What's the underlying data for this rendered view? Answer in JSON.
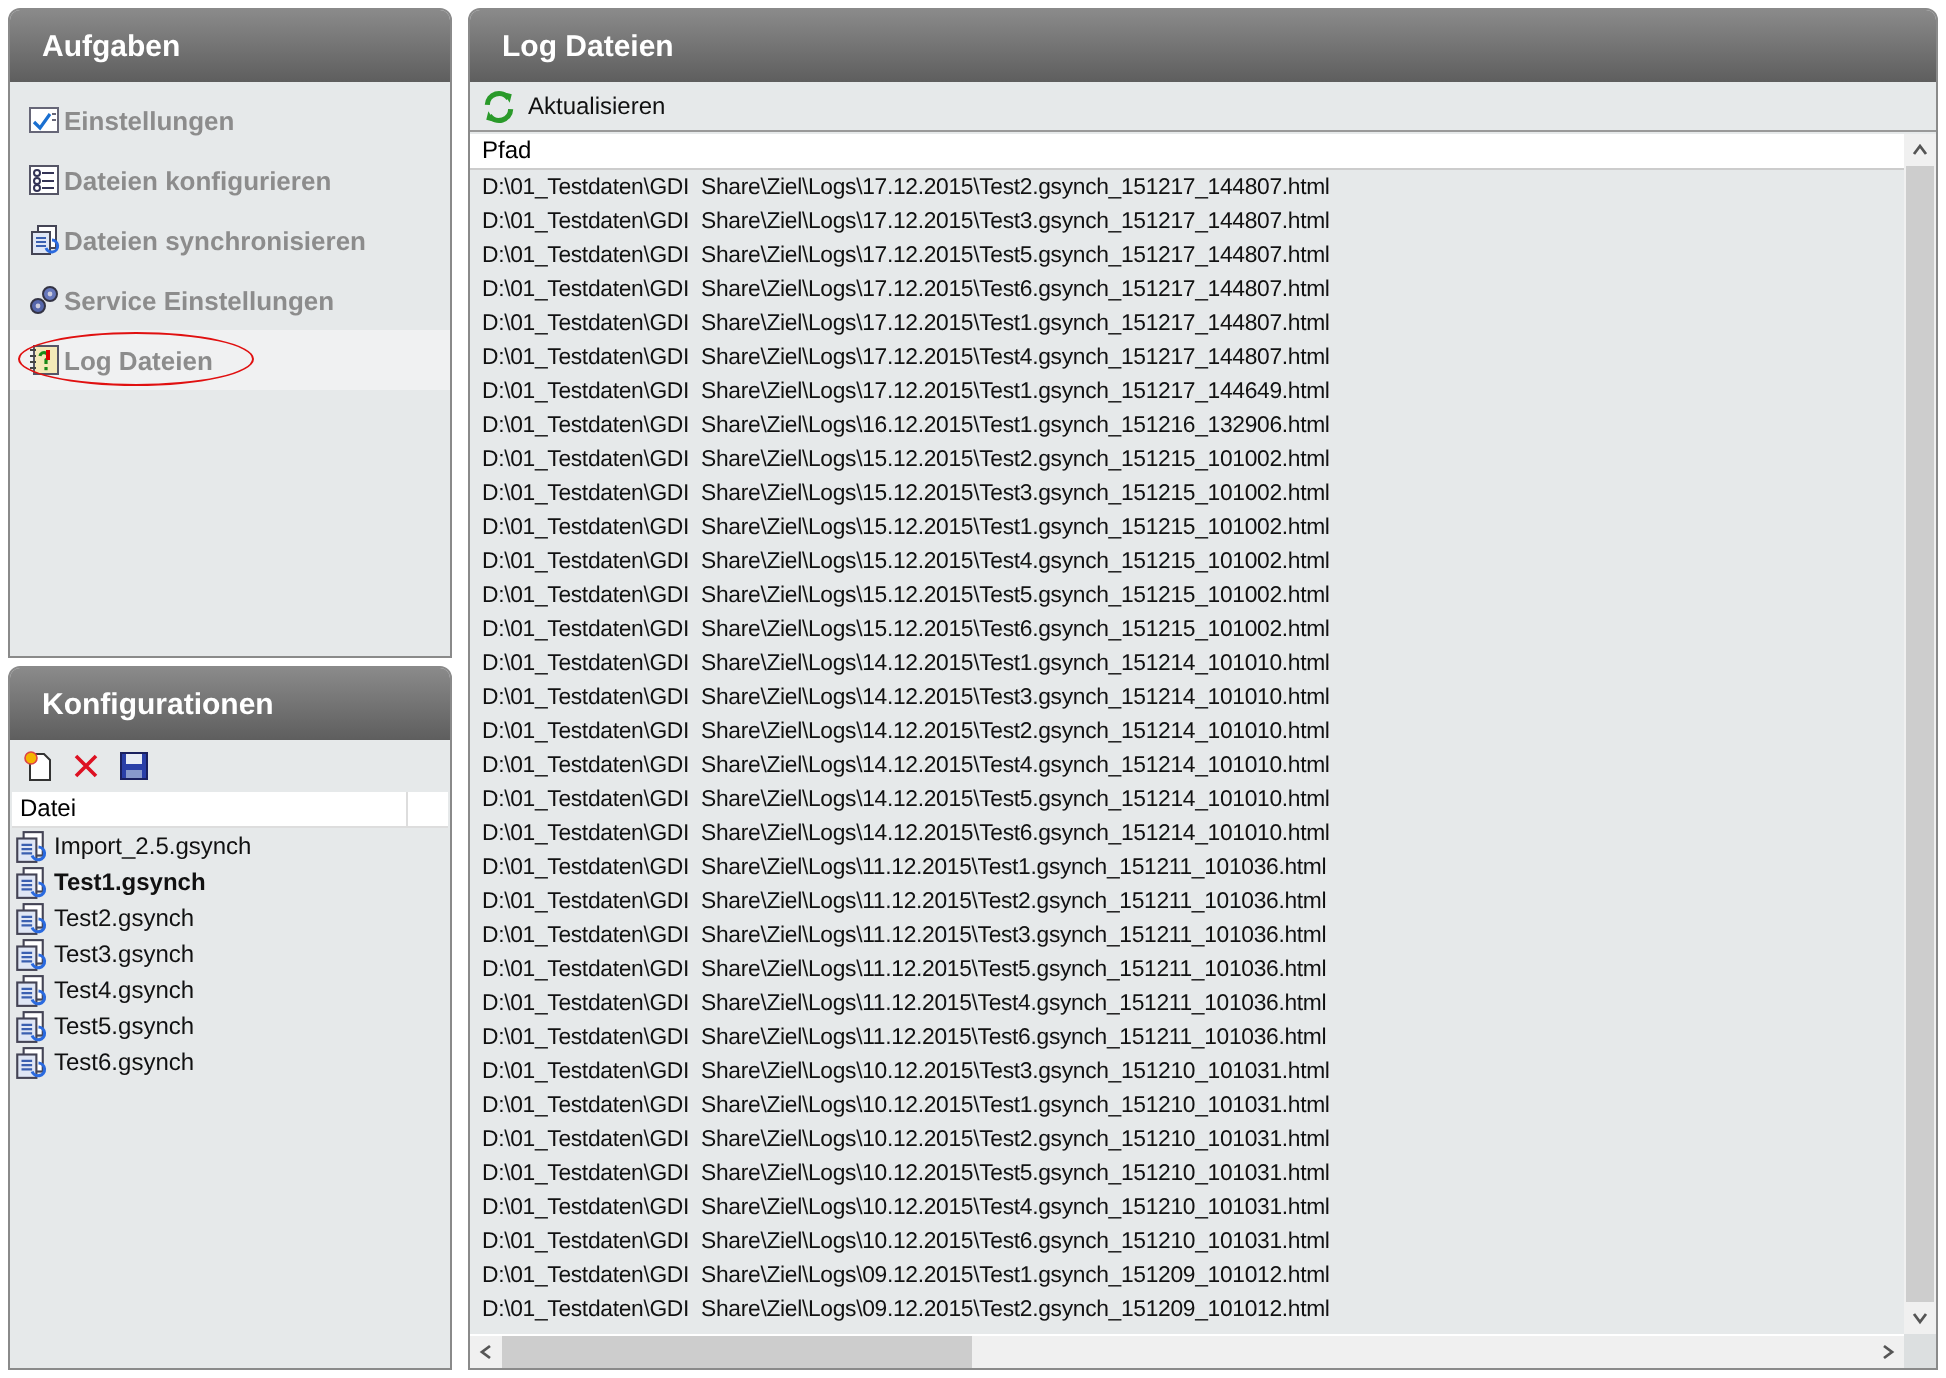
{
  "tasks_panel": {
    "title": "Aufgaben",
    "items": [
      {
        "label": "Einstellungen",
        "selected": false
      },
      {
        "label": "Dateien konfigurieren",
        "selected": false
      },
      {
        "label": "Dateien synchronisieren",
        "selected": false
      },
      {
        "label": "Service Einstellungen",
        "selected": false
      },
      {
        "label": "Log Dateien",
        "selected": true
      }
    ]
  },
  "configs_panel": {
    "title": "Konfigurationen",
    "column": "Datei",
    "files": [
      {
        "name": "Import_2.5.gsynch",
        "selected": false
      },
      {
        "name": "Test1.gsynch",
        "selected": true
      },
      {
        "name": "Test2.gsynch",
        "selected": false
      },
      {
        "name": "Test3.gsynch",
        "selected": false
      },
      {
        "name": "Test4.gsynch",
        "selected": false
      },
      {
        "name": "Test5.gsynch",
        "selected": false
      },
      {
        "name": "Test6.gsynch",
        "selected": false
      }
    ]
  },
  "log_panel": {
    "title": "Log Dateien",
    "refresh_button": "Aktualisieren",
    "column": "Pfad",
    "rows": [
      "D:\\01_Testdaten\\GDI  Share\\Ziel\\Logs\\17.12.2015\\Test2.gsynch_151217_144807.html",
      "D:\\01_Testdaten\\GDI  Share\\Ziel\\Logs\\17.12.2015\\Test3.gsynch_151217_144807.html",
      "D:\\01_Testdaten\\GDI  Share\\Ziel\\Logs\\17.12.2015\\Test5.gsynch_151217_144807.html",
      "D:\\01_Testdaten\\GDI  Share\\Ziel\\Logs\\17.12.2015\\Test6.gsynch_151217_144807.html",
      "D:\\01_Testdaten\\GDI  Share\\Ziel\\Logs\\17.12.2015\\Test1.gsynch_151217_144807.html",
      "D:\\01_Testdaten\\GDI  Share\\Ziel\\Logs\\17.12.2015\\Test4.gsynch_151217_144807.html",
      "D:\\01_Testdaten\\GDI  Share\\Ziel\\Logs\\17.12.2015\\Test1.gsynch_151217_144649.html",
      "D:\\01_Testdaten\\GDI  Share\\Ziel\\Logs\\16.12.2015\\Test1.gsynch_151216_132906.html",
      "D:\\01_Testdaten\\GDI  Share\\Ziel\\Logs\\15.12.2015\\Test2.gsynch_151215_101002.html",
      "D:\\01_Testdaten\\GDI  Share\\Ziel\\Logs\\15.12.2015\\Test3.gsynch_151215_101002.html",
      "D:\\01_Testdaten\\GDI  Share\\Ziel\\Logs\\15.12.2015\\Test1.gsynch_151215_101002.html",
      "D:\\01_Testdaten\\GDI  Share\\Ziel\\Logs\\15.12.2015\\Test4.gsynch_151215_101002.html",
      "D:\\01_Testdaten\\GDI  Share\\Ziel\\Logs\\15.12.2015\\Test5.gsynch_151215_101002.html",
      "D:\\01_Testdaten\\GDI  Share\\Ziel\\Logs\\15.12.2015\\Test6.gsynch_151215_101002.html",
      "D:\\01_Testdaten\\GDI  Share\\Ziel\\Logs\\14.12.2015\\Test1.gsynch_151214_101010.html",
      "D:\\01_Testdaten\\GDI  Share\\Ziel\\Logs\\14.12.2015\\Test3.gsynch_151214_101010.html",
      "D:\\01_Testdaten\\GDI  Share\\Ziel\\Logs\\14.12.2015\\Test2.gsynch_151214_101010.html",
      "D:\\01_Testdaten\\GDI  Share\\Ziel\\Logs\\14.12.2015\\Test4.gsynch_151214_101010.html",
      "D:\\01_Testdaten\\GDI  Share\\Ziel\\Logs\\14.12.2015\\Test5.gsynch_151214_101010.html",
      "D:\\01_Testdaten\\GDI  Share\\Ziel\\Logs\\14.12.2015\\Test6.gsynch_151214_101010.html",
      "D:\\01_Testdaten\\GDI  Share\\Ziel\\Logs\\11.12.2015\\Test1.gsynch_151211_101036.html",
      "D:\\01_Testdaten\\GDI  Share\\Ziel\\Logs\\11.12.2015\\Test2.gsynch_151211_101036.html",
      "D:\\01_Testdaten\\GDI  Share\\Ziel\\Logs\\11.12.2015\\Test3.gsynch_151211_101036.html",
      "D:\\01_Testdaten\\GDI  Share\\Ziel\\Logs\\11.12.2015\\Test5.gsynch_151211_101036.html",
      "D:\\01_Testdaten\\GDI  Share\\Ziel\\Logs\\11.12.2015\\Test4.gsynch_151211_101036.html",
      "D:\\01_Testdaten\\GDI  Share\\Ziel\\Logs\\11.12.2015\\Test6.gsynch_151211_101036.html",
      "D:\\01_Testdaten\\GDI  Share\\Ziel\\Logs\\10.12.2015\\Test3.gsynch_151210_101031.html",
      "D:\\01_Testdaten\\GDI  Share\\Ziel\\Logs\\10.12.2015\\Test1.gsynch_151210_101031.html",
      "D:\\01_Testdaten\\GDI  Share\\Ziel\\Logs\\10.12.2015\\Test2.gsynch_151210_101031.html",
      "D:\\01_Testdaten\\GDI  Share\\Ziel\\Logs\\10.12.2015\\Test5.gsynch_151210_101031.html",
      "D:\\01_Testdaten\\GDI  Share\\Ziel\\Logs\\10.12.2015\\Test4.gsynch_151210_101031.html",
      "D:\\01_Testdaten\\GDI  Share\\Ziel\\Logs\\10.12.2015\\Test6.gsynch_151210_101031.html",
      "D:\\01_Testdaten\\GDI  Share\\Ziel\\Logs\\09.12.2015\\Test1.gsynch_151209_101012.html",
      "D:\\01_Testdaten\\GDI  Share\\Ziel\\Logs\\09.12.2015\\Test2.gsynch_151209_101012.html"
    ]
  }
}
